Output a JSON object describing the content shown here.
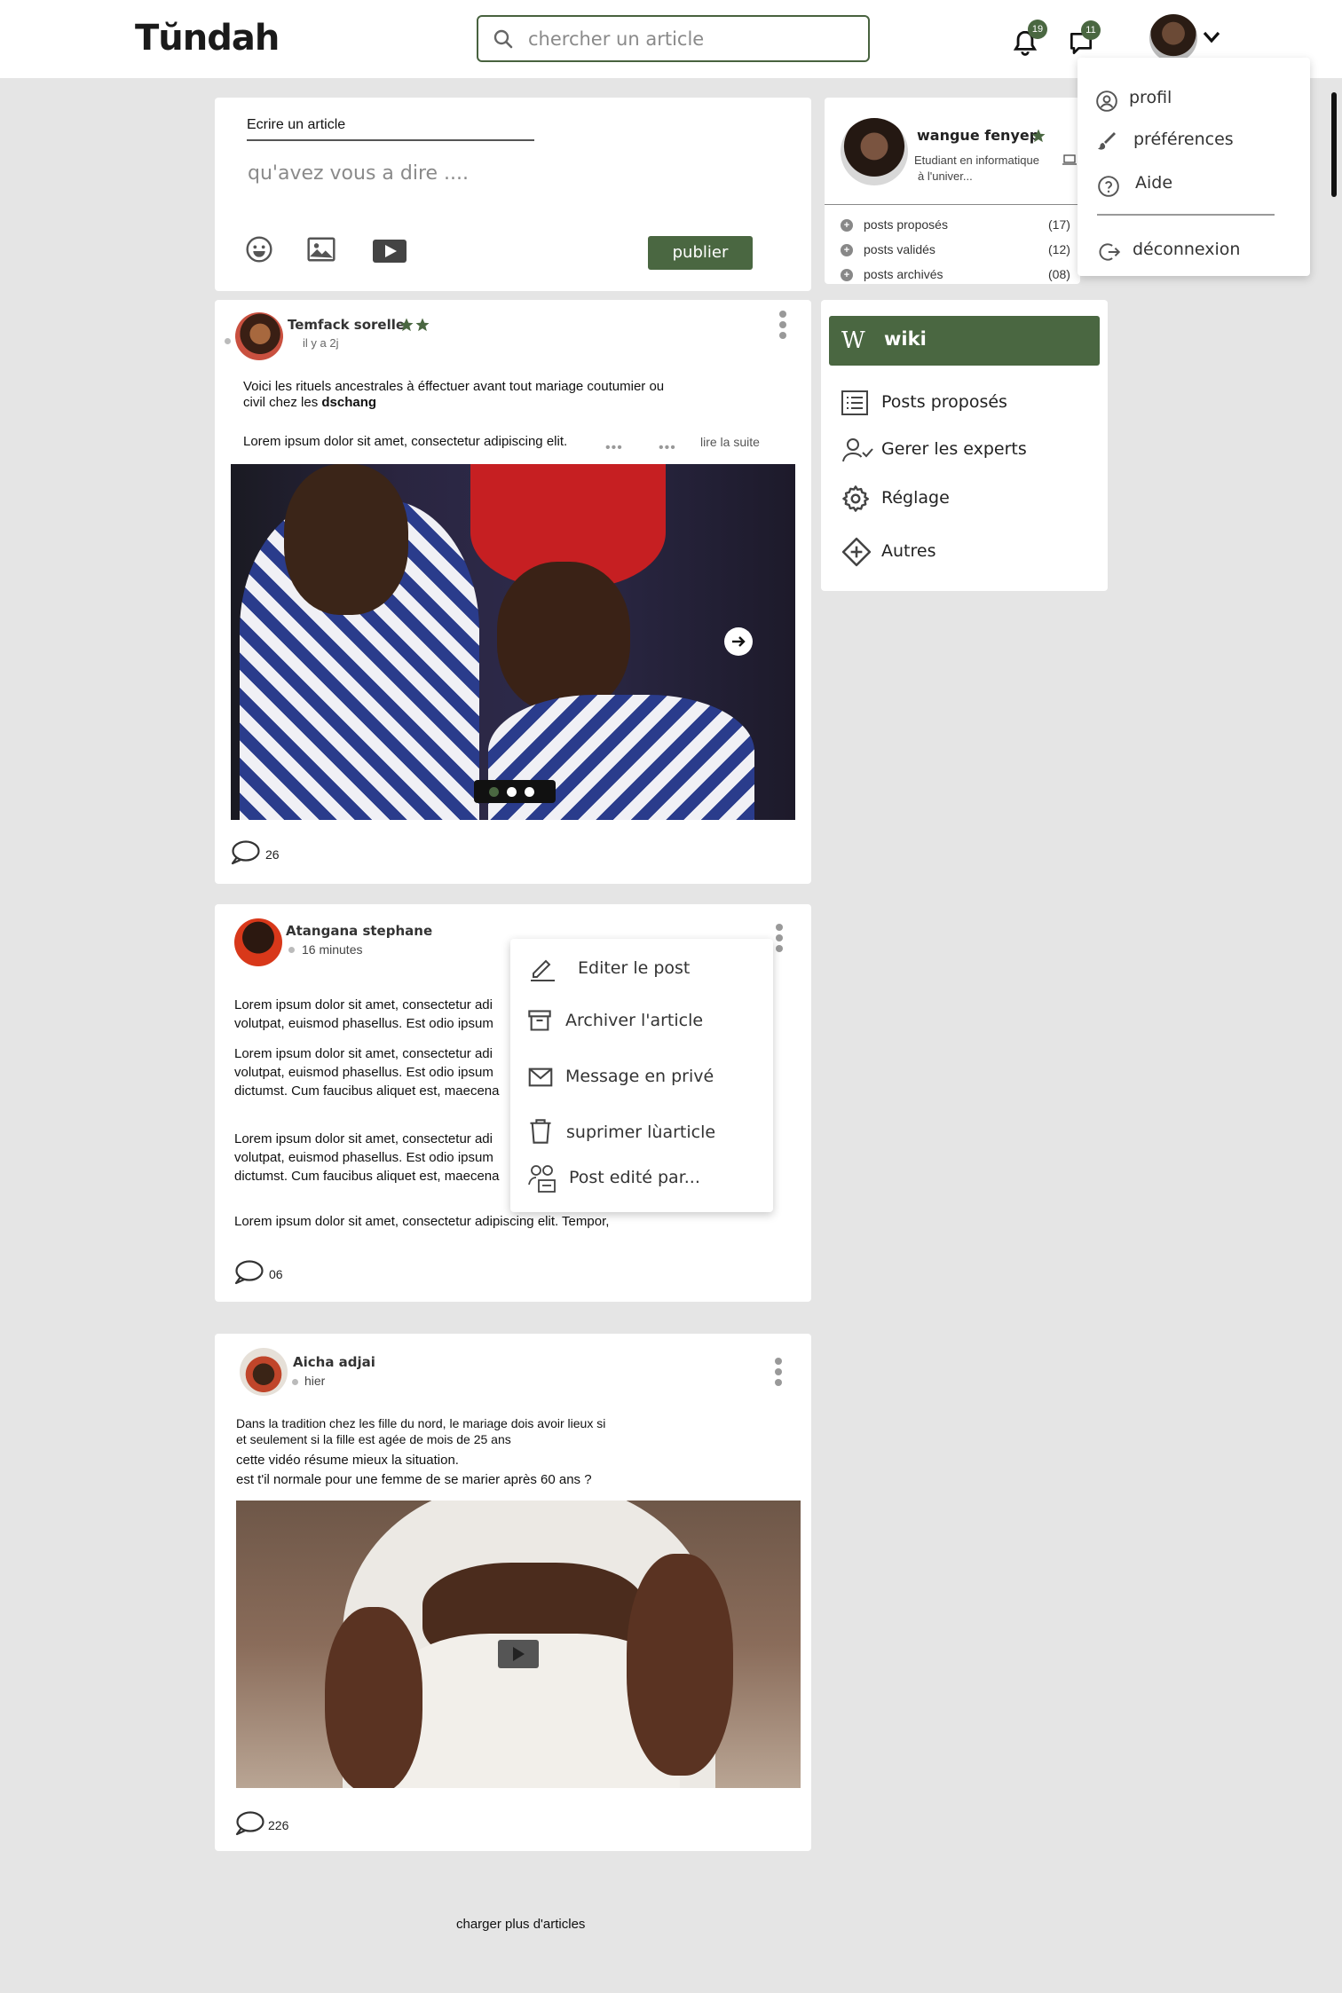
{
  "app": {
    "logo": "Tŭndah"
  },
  "search": {
    "placeholder": "chercher un article"
  },
  "notifications": {
    "count": "19"
  },
  "messages": {
    "count": "11"
  },
  "user_menu": {
    "items": [
      {
        "label": "profil",
        "icon": "user-circle-icon"
      },
      {
        "label": "préférences",
        "icon": "brush-icon"
      },
      {
        "label": "Aide",
        "icon": "help-icon"
      },
      {
        "label": "déconnexion",
        "icon": "logout-icon"
      }
    ]
  },
  "composer": {
    "tab_label": "Ecrire un article",
    "placeholder": "qu'avez vous a dire ....",
    "publish_label": "publier"
  },
  "profile": {
    "name": "wangue fenyep",
    "bio_line1": "Etudiant en informatique",
    "bio_line2": "à l'univer...",
    "stats": [
      {
        "label": "posts proposés",
        "count": "(17)"
      },
      {
        "label": "posts validés",
        "count": "(12)"
      },
      {
        "label": "posts archivés",
        "count": "(08)"
      }
    ]
  },
  "sidebar": {
    "wiki_label": "wiki",
    "links": [
      {
        "label": "Posts proposés",
        "icon": "list-icon"
      },
      {
        "label": "Gerer les experts",
        "icon": "user-check-icon"
      },
      {
        "label": "Réglage",
        "icon": "gear-icon"
      },
      {
        "label": "Autres",
        "icon": "diamond-plus-icon"
      }
    ]
  },
  "posts": [
    {
      "author": "Temfack sorelle",
      "time": "il y a 2j",
      "text1": "Voici les rituels ancestrales à éffectuer  avant  tout mariage coutumier ou",
      "text2": "civil chez les ",
      "text2_bold": "dschang",
      "excerpt": "Lorem ipsum dolor sit amet, consectetur adipiscing elit.",
      "read_more": "lire la suite",
      "comments": "26"
    },
    {
      "author": "Atangana stephane",
      "time": "16 minutes",
      "p1a": "Lorem ipsum dolor sit amet, consectetur adi",
      "p1b": "volutpat, euismod phasellus. Est odio ipsum",
      "p2a": "Lorem ipsum dolor sit amet, consectetur adi",
      "p2b": "volutpat, euismod phasellus. Est odio ipsum",
      "p2c": "dictumst. Cum faucibus aliquet est, maecena",
      "p3a": "Lorem ipsum dolor sit amet, consectetur adi",
      "p3b": "volutpat, euismod phasellus. Est odio ipsum",
      "p3c": "dictumst. Cum faucibus aliquet est, maecena",
      "p4": "Lorem ipsum dolor sit amet, consectetur adipiscing elit. Tempor,",
      "comments": "06"
    },
    {
      "author": "Aicha adjai",
      "time": "hier",
      "line1": "Dans la tradition chez les fille du nord, le mariage dois avoir lieux si",
      "line2": "et seulement si la fille est agée de mois de 25 ans",
      "line3": "cette vidéo résume mieux la situation.",
      "line4": "est t'il normale pour une femme de se marier après 60 ans ?",
      "comments": "226"
    }
  ],
  "post_menu": {
    "items": [
      {
        "label": "Editer le post",
        "icon": "pencil-icon"
      },
      {
        "label": "Archiver l'article",
        "icon": "archive-icon"
      },
      {
        "label": "Message en privé",
        "icon": "mail-icon"
      },
      {
        "label": "suprimer lùarticle",
        "icon": "trash-icon"
      },
      {
        "label": "Post edité par...",
        "icon": "users-icon"
      }
    ]
  },
  "load_more": "charger plus d'articles",
  "colors": {
    "accent": "#4a6741",
    "background": "#e5e5e5"
  }
}
